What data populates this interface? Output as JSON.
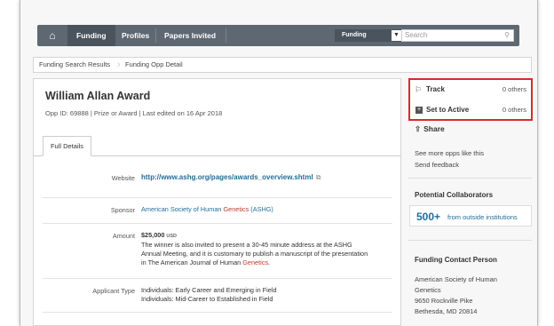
{
  "nav": {
    "home_icon": "home-icon",
    "items": [
      "Funding",
      "Profiles",
      "Papers Invited"
    ],
    "select_value": "Funding",
    "search_placeholder": "Search"
  },
  "breadcrumb": [
    "Funding Search Results",
    "Funding Opp Detail"
  ],
  "opp": {
    "title": "William Allan Award",
    "meta": "Opp ID: 69888  |  Prize or Award  |  Last edited on 16 Apr 2018",
    "tab": "Full Details"
  },
  "details": {
    "website_label": "Website",
    "website_value": "http://www.ashg.org/pages/awards_overview.shtml",
    "sponsor_label": "Sponsor",
    "sponsor_pre": "American Society of Human ",
    "sponsor_red": "Genetics",
    "sponsor_post": " (ASHG)",
    "amount_label": "Amount",
    "amount_value": "$25,000",
    "amount_currency": "USD",
    "amount_desc_1": "The winner is also invited to present a 30-45 minute address at the ASHG",
    "amount_desc_2": "Annual Meeting, and it is customary to publish a manuscript of the presentation",
    "amount_desc_3_pre": "in The American Journal of Human ",
    "amount_desc_3_red": "Genetics",
    "amount_desc_3_post": ".",
    "applicant_label": "Applicant Type",
    "applicant_1": "Individuals: Early Career and Emerging in Field",
    "applicant_2": "Individuals: Mid-Career to Established in Field"
  },
  "sidebar": {
    "track_label": "Track",
    "track_count": "0 others",
    "active_label": "Set to Active",
    "active_count": "0 others",
    "share_label": "Share",
    "see_more": "See more opps like this",
    "send_feedback": "Send feedback",
    "collab_title": "Potential Collaborators",
    "collab_number": "500+",
    "collab_text": "from outside institutions",
    "contact_title": "Funding Contact Person",
    "contact_line1": "American Society of Human",
    "contact_line2": "Genetics",
    "contact_line3": "9650 Rockville Pike",
    "contact_line4": "Bethesda, MD 20814"
  },
  "colors": {
    "nav_bg": "#5d6873",
    "link": "#1f6e9a",
    "highlight_box": "#d52b2b",
    "keyword": "#c0392b"
  }
}
